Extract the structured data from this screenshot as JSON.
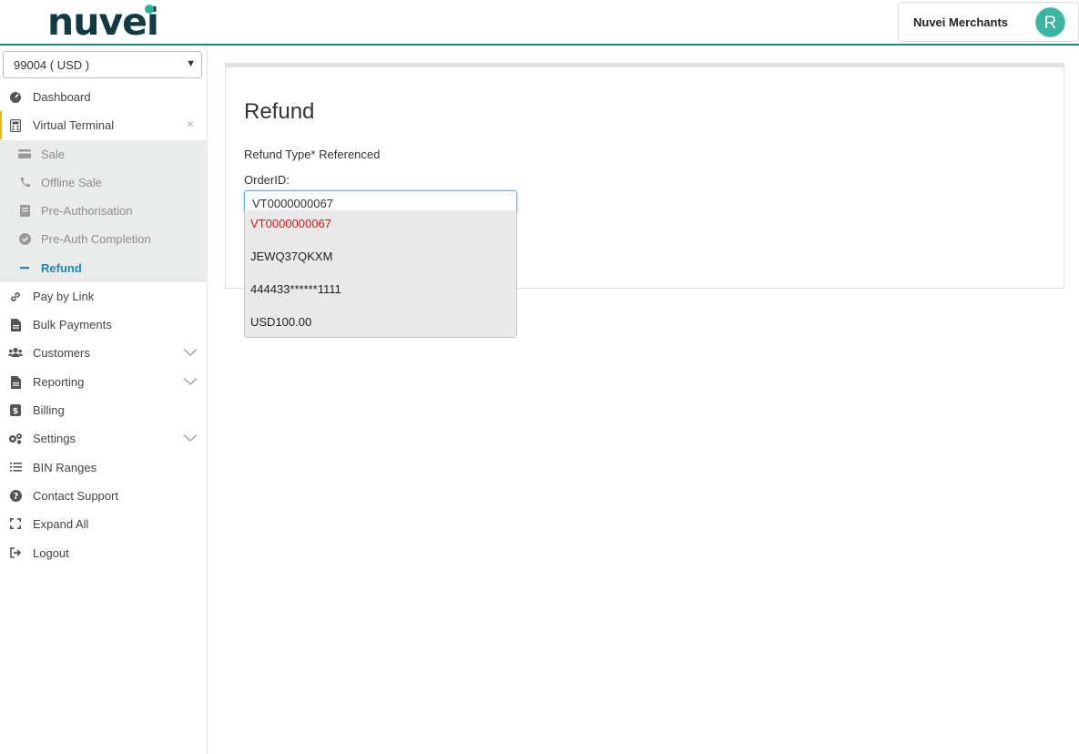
{
  "header": {
    "logo_text": "nuvei",
    "user_name": "Nuvei Merchants",
    "avatar_letter": "R"
  },
  "sidebar": {
    "account_select": "99004 ( USD )",
    "items": {
      "dashboard": "Dashboard",
      "virtual_terminal": "Virtual Terminal",
      "pay_by_link": "Pay by Link",
      "bulk_payments": "Bulk Payments",
      "customers": "Customers",
      "reporting": "Reporting",
      "billing": "Billing",
      "settings": "Settings",
      "bin_ranges": "BIN Ranges",
      "contact_support": "Contact Support",
      "expand_all": "Expand All",
      "logout": "Logout"
    },
    "submenu": {
      "sale": "Sale",
      "offline_sale": "Offline Sale",
      "pre_authorisation": "Pre-Authorisation",
      "pre_auth_completion": "Pre-Auth Completion",
      "refund": "Refund"
    },
    "close_symbol": "×"
  },
  "main": {
    "title": "Refund",
    "refund_type_label": "Refund Type* Referenced",
    "order_id_label": "OrderID:",
    "order_id_value": "VT0000000067",
    "suggestions": [
      "VT0000000067",
      "JEWQ37QKXM",
      "444433******1111",
      "USD100.00"
    ]
  },
  "colors": {
    "accent": "#2a7f8c",
    "active_link": "#1c86b8",
    "highlight_red": "#d11a1a",
    "avatar_bg": "#3cb4a2"
  }
}
